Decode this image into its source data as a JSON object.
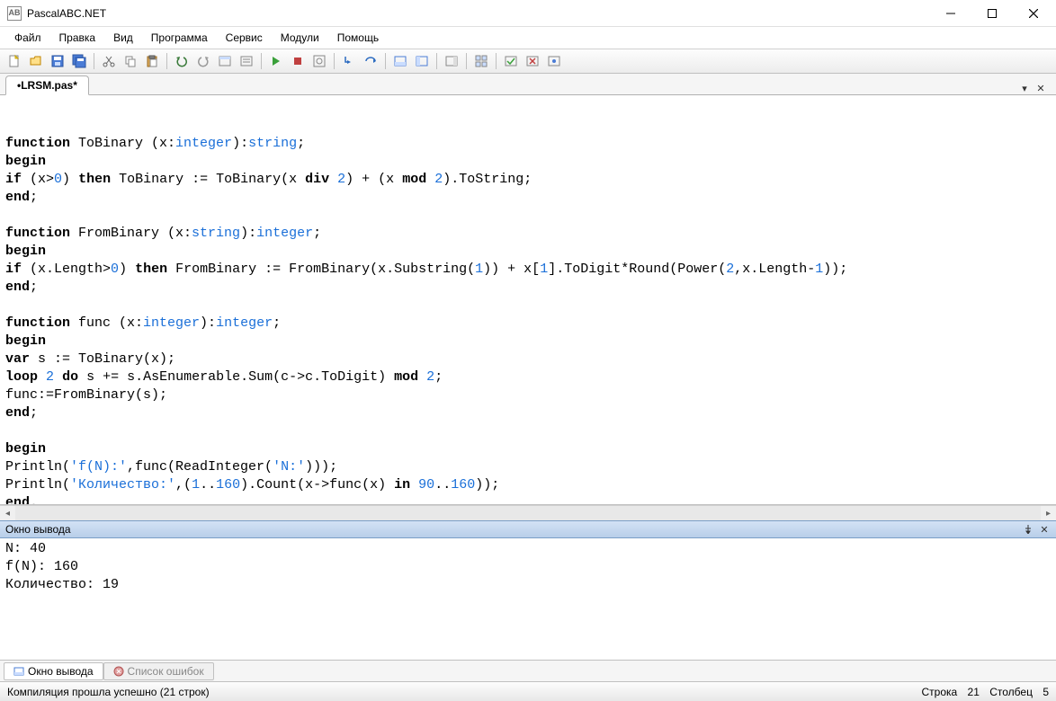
{
  "window": {
    "title": "PascalABC.NET",
    "app_icon_text": "AB"
  },
  "menu": {
    "items": [
      "Файл",
      "Правка",
      "Вид",
      "Программа",
      "Сервис",
      "Модули",
      "Помощь"
    ]
  },
  "tabs": {
    "active": "•LRSM.pas*"
  },
  "code": {
    "lines": [
      [
        {
          "t": "function",
          "c": "kw"
        },
        {
          "t": " ToBinary (x:"
        },
        {
          "t": "integer",
          "c": "typ"
        },
        {
          "t": "):"
        },
        {
          "t": "string",
          "c": "typ"
        },
        {
          "t": ";"
        }
      ],
      [
        {
          "t": "begin",
          "c": "kw"
        }
      ],
      [
        {
          "t": "if",
          "c": "kw"
        },
        {
          "t": " (x>"
        },
        {
          "t": "0",
          "c": "num"
        },
        {
          "t": ") "
        },
        {
          "t": "then",
          "c": "kw"
        },
        {
          "t": " ToBinary := ToBinary(x "
        },
        {
          "t": "div",
          "c": "kw"
        },
        {
          "t": " "
        },
        {
          "t": "2",
          "c": "num"
        },
        {
          "t": ") + (x "
        },
        {
          "t": "mod",
          "c": "kw"
        },
        {
          "t": " "
        },
        {
          "t": "2",
          "c": "num"
        },
        {
          "t": ").ToString;"
        }
      ],
      [
        {
          "t": "end",
          "c": "kw"
        },
        {
          "t": ";"
        }
      ],
      [
        {
          "t": ""
        }
      ],
      [
        {
          "t": "function",
          "c": "kw"
        },
        {
          "t": " FromBinary (x:"
        },
        {
          "t": "string",
          "c": "typ"
        },
        {
          "t": "):"
        },
        {
          "t": "integer",
          "c": "typ"
        },
        {
          "t": ";"
        }
      ],
      [
        {
          "t": "begin",
          "c": "kw"
        }
      ],
      [
        {
          "t": "if",
          "c": "kw"
        },
        {
          "t": " (x.Length>"
        },
        {
          "t": "0",
          "c": "num"
        },
        {
          "t": ") "
        },
        {
          "t": "then",
          "c": "kw"
        },
        {
          "t": " FromBinary := FromBinary(x.Substring("
        },
        {
          "t": "1",
          "c": "num"
        },
        {
          "t": ")) + x["
        },
        {
          "t": "1",
          "c": "num"
        },
        {
          "t": "].ToDigit*Round(Power("
        },
        {
          "t": "2",
          "c": "num"
        },
        {
          "t": ",x.Length-"
        },
        {
          "t": "1",
          "c": "num"
        },
        {
          "t": "));"
        }
      ],
      [
        {
          "t": "end",
          "c": "kw"
        },
        {
          "t": ";"
        }
      ],
      [
        {
          "t": ""
        }
      ],
      [
        {
          "t": "function",
          "c": "kw"
        },
        {
          "t": " func (x:"
        },
        {
          "t": "integer",
          "c": "typ"
        },
        {
          "t": "):"
        },
        {
          "t": "integer",
          "c": "typ"
        },
        {
          "t": ";"
        }
      ],
      [
        {
          "t": "begin",
          "c": "kw"
        }
      ],
      [
        {
          "t": "var",
          "c": "kw"
        },
        {
          "t": " s := ToBinary(x);"
        }
      ],
      [
        {
          "t": "loop",
          "c": "kw"
        },
        {
          "t": " "
        },
        {
          "t": "2",
          "c": "num"
        },
        {
          "t": " "
        },
        {
          "t": "do",
          "c": "kw"
        },
        {
          "t": " s += s.AsEnumerable.Sum(c->c.ToDigit) "
        },
        {
          "t": "mod",
          "c": "kw"
        },
        {
          "t": " "
        },
        {
          "t": "2",
          "c": "num"
        },
        {
          "t": ";"
        }
      ],
      [
        {
          "t": "func:=FromBinary(s);"
        }
      ],
      [
        {
          "t": "end",
          "c": "kw"
        },
        {
          "t": ";"
        }
      ],
      [
        {
          "t": ""
        }
      ],
      [
        {
          "t": "begin",
          "c": "kw"
        }
      ],
      [
        {
          "t": "Println("
        },
        {
          "t": "'f(N):'",
          "c": "str"
        },
        {
          "t": ",func(ReadInteger("
        },
        {
          "t": "'N:'",
          "c": "str"
        },
        {
          "t": ")));"
        }
      ],
      [
        {
          "t": "Println("
        },
        {
          "t": "'Количество:'",
          "c": "str"
        },
        {
          "t": ",("
        },
        {
          "t": "1",
          "c": "num"
        },
        {
          "t": ".."
        },
        {
          "t": "160",
          "c": "num"
        },
        {
          "t": ").Count(x->func(x) "
        },
        {
          "t": "in",
          "c": "kw"
        },
        {
          "t": " "
        },
        {
          "t": "90",
          "c": "num"
        },
        {
          "t": ".."
        },
        {
          "t": "160",
          "c": "num"
        },
        {
          "t": "));"
        }
      ],
      [
        {
          "t": "end",
          "c": "kw"
        },
        {
          "t": "."
        }
      ]
    ]
  },
  "output": {
    "header": "Окно вывода",
    "lines": [
      "N: 40",
      "f(N): 160",
      "Количество: 19"
    ]
  },
  "bottom_tabs": {
    "output": "Окно вывода",
    "errors": "Список ошибок"
  },
  "status": {
    "left": "Компиляция прошла успешно (21 строк)",
    "line_label": "Строка",
    "line_val": "21",
    "col_label": "Столбец",
    "col_val": "5"
  }
}
